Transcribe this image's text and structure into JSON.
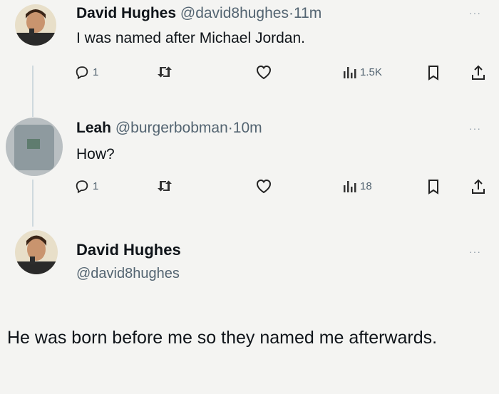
{
  "tweets": [
    {
      "name": "David Hughes",
      "handle": "@david8hughes",
      "sep": "·",
      "time": "11m",
      "text": "I was named after Michael Jordan.",
      "replies": "1",
      "views": "1.5K"
    },
    {
      "name": "Leah",
      "handle": "@burgerbobman",
      "sep": "·",
      "time": "10m",
      "text": "How?",
      "replies": "1",
      "views": "18"
    }
  ],
  "main": {
    "name": "David Hughes",
    "handle": "@david8hughes",
    "text": "He was born before me so they named me afterwards."
  },
  "more_label": "···",
  "colors": {
    "muted": "#536471",
    "line": "#cfd9de"
  }
}
